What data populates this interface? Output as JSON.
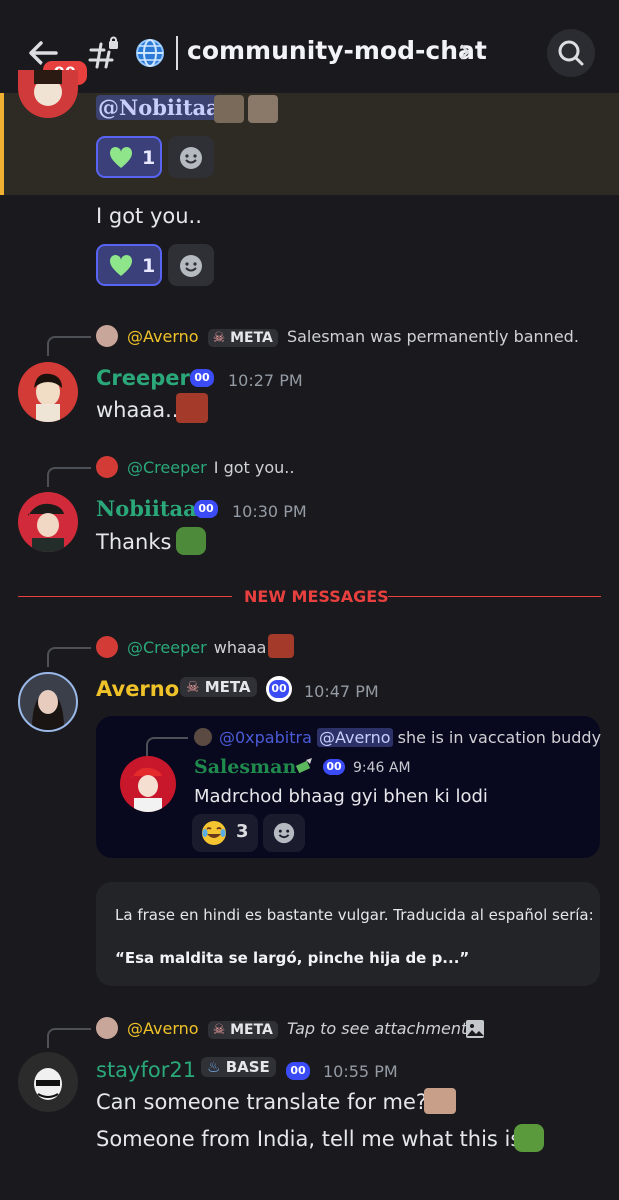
{
  "header": {
    "channel_name": "community-mod-chat",
    "unread_count": "99"
  },
  "messages": {
    "top_mention": "@Nobiitaa",
    "top_reaction_count": "1",
    "igot_text": "I got you..",
    "igot_reaction_count": "1",
    "creeper": {
      "reply_user": "@Averno",
      "reply_tag": "META",
      "reply_text": "Salesman was permanently banned.",
      "name": "Creeper",
      "bot": "00",
      "time": "10:27 PM",
      "text": "whaaa.."
    },
    "nobiitaa": {
      "reply_user": "@Creeper",
      "reply_text": "I got you..",
      "name": "Nobiitaa",
      "bot": "00",
      "time": "10:30 PM",
      "text": "Thanks"
    },
    "new_messages_label": "NEW MESSAGES",
    "averno": {
      "reply_user": "@Creeper",
      "reply_text": "whaaa..",
      "name": "Averno",
      "tag": "META",
      "bot": "00",
      "time": "10:47 PM",
      "embed": {
        "reply_user": "@0xpabitra",
        "reply_mention": "@Averno",
        "reply_text": "she is in vaccation buddy",
        "name": "Salesman",
        "bot": "00",
        "time": "9:46 AM",
        "text": "Madrchod bhaag gyi bhen ki lodi",
        "reaction_count": "3"
      }
    },
    "translation": {
      "line1": "La frase en hindi es bastante vulgar. Traducida al español sería:",
      "line2": "“Esa maldita se largó, pinche hija de p...”"
    },
    "stayfor": {
      "reply_user": "@Averno",
      "reply_tag": "META",
      "reply_text": "Tap to see attachment",
      "name": "stayfor21",
      "tag": "BASE",
      "bot": "00",
      "time": "10:55 PM",
      "text1": "Can someone translate for me?",
      "text2": "Someone from India, tell me what this is"
    }
  },
  "colors": {
    "creeper": "#2aa879",
    "nobiitaa": "#2aa879",
    "averno": "#f0c229",
    "salesman": "#1f8a4c",
    "stayfor": "#2aa879",
    "new_messages": "#e8403f"
  }
}
